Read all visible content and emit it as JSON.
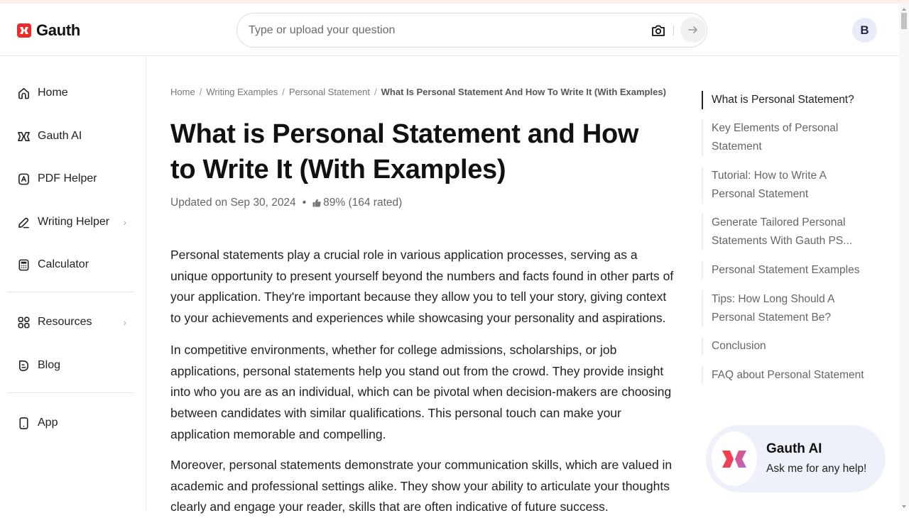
{
  "header": {
    "brand": "Gauth",
    "search_placeholder": "Type or upload your question",
    "avatar_initial": "B"
  },
  "sidebar": {
    "items": [
      {
        "label": "Home",
        "icon": "home-icon"
      },
      {
        "label": "Gauth AI",
        "icon": "gauth-ai-icon"
      },
      {
        "label": "PDF Helper",
        "icon": "pdf-icon"
      },
      {
        "label": "Writing Helper",
        "icon": "pen-icon",
        "has_submenu": true
      },
      {
        "label": "Calculator",
        "icon": "calculator-icon"
      },
      {
        "label": "Resources",
        "icon": "grid-icon",
        "has_submenu": true
      },
      {
        "label": "Blog",
        "icon": "blog-icon"
      },
      {
        "label": "App",
        "icon": "phone-icon"
      }
    ]
  },
  "breadcrumb": {
    "items": [
      "Home",
      "Writing Examples",
      "Personal Statement"
    ],
    "current": "What Is Personal Statement And How To Write It (With Examples)",
    "separator": "/"
  },
  "article": {
    "title": "What is Personal Statement and How to Write It (With Examples)",
    "updated": "Updated on Sep 30, 2024",
    "rating": "89% (164 rated)",
    "paragraphs": [
      "Personal statements play a crucial role in various application processes, serving as a unique opportunity to present yourself beyond the numbers and facts found in other parts of your application. They're important because they allow you to tell your story, giving context to your achievements and experiences while showcasing your personality and aspirations.",
      "In competitive environments, whether for college admissions, scholarships, or job applications, personal statements help you stand out from the crowd. They provide insight into who you are as an individual, which can be pivotal when decision-makers are choosing between candidates with similar qualifications. This personal touch can make your application memorable and compelling.",
      "Moreover, personal statements demonstrate your communication skills, which are valued in academic and professional settings alike. They show your ability to articulate your thoughts clearly and engage your reader, skills that are often indicative of future success."
    ]
  },
  "toc": {
    "items": [
      {
        "label": "What is Personal Statement?",
        "active": true
      },
      {
        "label": "Key Elements of Personal Statement",
        "active": false
      },
      {
        "label": "Tutorial: How to Write A Personal Statement",
        "active": false
      },
      {
        "label": "Generate Tailored Personal Statements With Gauth PS...",
        "active": false
      },
      {
        "label": "Personal Statement Examples",
        "active": false
      },
      {
        "label": "Tips: How Long Should A Personal Statement Be?",
        "active": false
      },
      {
        "label": "Conclusion",
        "active": false
      },
      {
        "label": "FAQ about Personal Statement",
        "active": false
      }
    ]
  },
  "ai_card": {
    "title": "Gauth AI",
    "subtitle": "Ask me for any help!"
  },
  "colors": {
    "brand_red": "#ee2b2b",
    "ai_card_bg": "#eef0fa",
    "avatar_bg": "#e8ecf8"
  }
}
